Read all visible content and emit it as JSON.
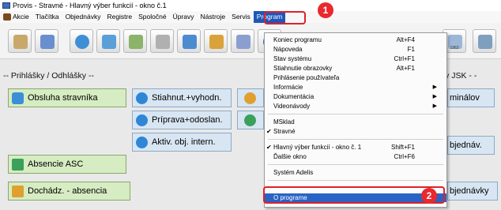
{
  "window": {
    "title": "Provis - Stravné - Hlavný výber funkcií - okno č.1"
  },
  "menubar": {
    "items": [
      "Akcie",
      "Tlačítka",
      "Objednávky",
      "Registre",
      "Spoločné",
      "Úpravy",
      "Nástroje",
      "Servis",
      "Program"
    ],
    "active": "Program"
  },
  "toolbar": {
    "last_label": "1963",
    "small_label_1": "",
    "small_label_2": ""
  },
  "main": {
    "section_left": "-- Prihlášky / Odhlášky --",
    "section_right": "avy JSK - -",
    "section_right2": "--",
    "buttons": {
      "obsluha": "Obsluha stravníka",
      "stiahnut": "Stiahnut.+vyhodn.",
      "priprava": "Príprava+odoslan.",
      "aktiv": "Aktiv. obj. intern.",
      "absencie": "Absencie ASC",
      "dochadz": "Dochádz. - absencia",
      "minalov": "minálov",
      "bjednav": "bjednáv.",
      "bjednavky": "bjednávky"
    }
  },
  "dropdown": {
    "items": [
      {
        "label": "Koniec programu",
        "shortcut": "Alt+F4"
      },
      {
        "label": "Nápoveda",
        "shortcut": "F1"
      },
      {
        "label": "Stav systému",
        "shortcut": "Ctrl+F1"
      },
      {
        "label": "Stiahnutie obrazovky",
        "shortcut": "Alt+F1"
      },
      {
        "label": "Prihlásenie používateľa",
        "shortcut": ""
      },
      {
        "label": "Informácie",
        "shortcut": ""
      },
      {
        "label": "Dokumentácia",
        "shortcut": ""
      },
      {
        "label": "Videonávody",
        "shortcut": ""
      },
      {
        "label": "MSklad",
        "shortcut": ""
      },
      {
        "label": "Stravné",
        "shortcut": ""
      },
      {
        "label": "Hlavný výber funkcií - okno č. 1",
        "shortcut": "Shift+F1"
      },
      {
        "label": "Ďalšie okno",
        "shortcut": "Ctrl+F6"
      },
      {
        "label": "Systém Adelis",
        "shortcut": ""
      },
      {
        "label": "O programe",
        "shortcut": ""
      }
    ]
  },
  "annotations": {
    "badge1": "1",
    "badge2": "2"
  },
  "colors": {
    "highlight": "#2a63c4",
    "annotation": "#e0202a",
    "green_button": "#d6ecc2"
  }
}
